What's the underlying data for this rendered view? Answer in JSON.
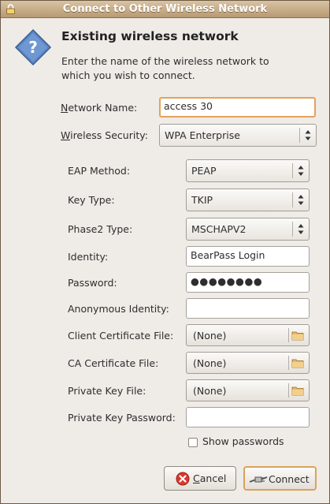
{
  "window": {
    "title": "Connect to Other Wireless Network"
  },
  "header": {
    "heading": "Existing wireless network",
    "description": "Enter the name of the wireless network to which you wish to connect."
  },
  "form": {
    "network_name_label_u": "N",
    "network_name_label_rest": "etwork Name:",
    "network_name_value": "access 30",
    "security_label_u": "W",
    "security_label_rest": "ireless Security:",
    "security_value": "WPA Enterprise",
    "eap_method_label": "EAP Method:",
    "eap_method_value": "PEAP",
    "key_type_label": "Key Type:",
    "key_type_value": "TKIP",
    "phase2_label": "Phase2 Type:",
    "phase2_value": "MSCHAPV2",
    "identity_label": "Identity:",
    "identity_value": "BearPass Login",
    "password_label": "Password:",
    "password_value": "●●●●●●●●",
    "anon_identity_label": "Anonymous Identity:",
    "anon_identity_value": "",
    "client_cert_label": "Client Certificate File:",
    "client_cert_value": "(None)",
    "ca_cert_label": "CA Certificate File:",
    "ca_cert_value": "(None)",
    "private_key_label": "Private Key File:",
    "private_key_value": "(None)",
    "private_key_password_label": "Private Key Password:",
    "private_key_password_value": "",
    "show_passwords_label": "Show passwords",
    "show_passwords_checked": false
  },
  "buttons": {
    "cancel_u": "C",
    "cancel_rest": "ancel",
    "connect_u": "",
    "connect_rest": "Connect"
  },
  "colors": {
    "title_bar": "#c9b08c",
    "focus_ring": "#e6a15a",
    "question_icon": "#5b87c4",
    "cancel_icon": "#d53b30"
  },
  "icons": [
    "lock-icon",
    "question-icon",
    "combo-arrows-icon",
    "folder-icon",
    "cancel-icon",
    "connect-icon"
  ]
}
